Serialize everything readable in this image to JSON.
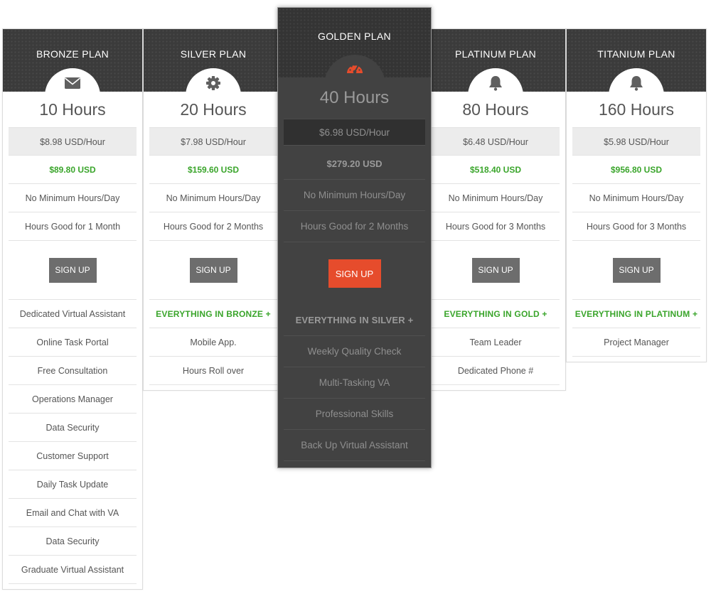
{
  "plans": [
    {
      "title": "BRONZE PLAN",
      "icon": "envelope-icon",
      "hours": "10 Hours",
      "rate": "$8.98 USD/Hour",
      "total": "$89.80 USD",
      "min_hours": "No Minimum Hours/Day",
      "validity": "Hours Good for 1 Month",
      "signup_label": "SIGN UP",
      "features": [
        "Dedicated Virtual Assistant",
        "Online Task Portal",
        "Free Consultation",
        "Operations Manager",
        "Data Security",
        "Customer Support",
        "Daily Task Update",
        "Email and Chat with VA",
        "Data Security",
        "Graduate Virtual Assistant"
      ]
    },
    {
      "title": "SILVER PLAN",
      "icon": "gear-icon",
      "hours": "20 Hours",
      "rate": "$7.98 USD/Hour",
      "total": "$159.60 USD",
      "min_hours": "No Minimum Hours/Day",
      "validity": "Hours Good for 2 Months",
      "signup_label": "SIGN UP",
      "included": "EVERYTHING IN BRONZE +",
      "features": [
        "Mobile App.",
        "Hours Roll over"
      ]
    },
    {
      "title": "GOLDEN PLAN",
      "icon": "speedometer-icon",
      "hours": "40 Hours",
      "rate": "$6.98 USD/Hour",
      "total": "$279.20 USD",
      "min_hours": "No Minimum Hours/Day",
      "validity": "Hours Good for 2 Months",
      "signup_label": "SIGN UP",
      "included": "EVERYTHING IN SILVER +",
      "features": [
        "Weekly Quality Check",
        "Multi-Tasking VA",
        "Professional Skills",
        "Back Up Virtual Assistant"
      ]
    },
    {
      "title": "PLATINUM PLAN",
      "icon": "bell-icon",
      "hours": "80 Hours",
      "rate": "$6.48 USD/Hour",
      "total": "$518.40 USD",
      "min_hours": "No Minimum Hours/Day",
      "validity": "Hours Good for 3 Months",
      "signup_label": "SIGN UP",
      "included": "EVERYTHING IN GOLD +",
      "features": [
        "Team Leader",
        "Dedicated Phone #"
      ]
    },
    {
      "title": "TITANIUM PLAN",
      "icon": "bell-icon",
      "hours": "160 Hours",
      "rate": "$5.98 USD/Hour",
      "total": "$956.80 USD",
      "min_hours": "No Minimum Hours/Day",
      "validity": "Hours Good for 3 Months",
      "signup_label": "SIGN UP",
      "included": "EVERYTHING IN PLATINUM +",
      "features": [
        "Project Manager"
      ]
    }
  ],
  "colors": {
    "header_dark": "#3b3b3b",
    "price_green": "#3aa52b",
    "signup_gray": "#6d6d6d",
    "signup_accent": "#e64c2c",
    "featured_bg": "#424242"
  }
}
